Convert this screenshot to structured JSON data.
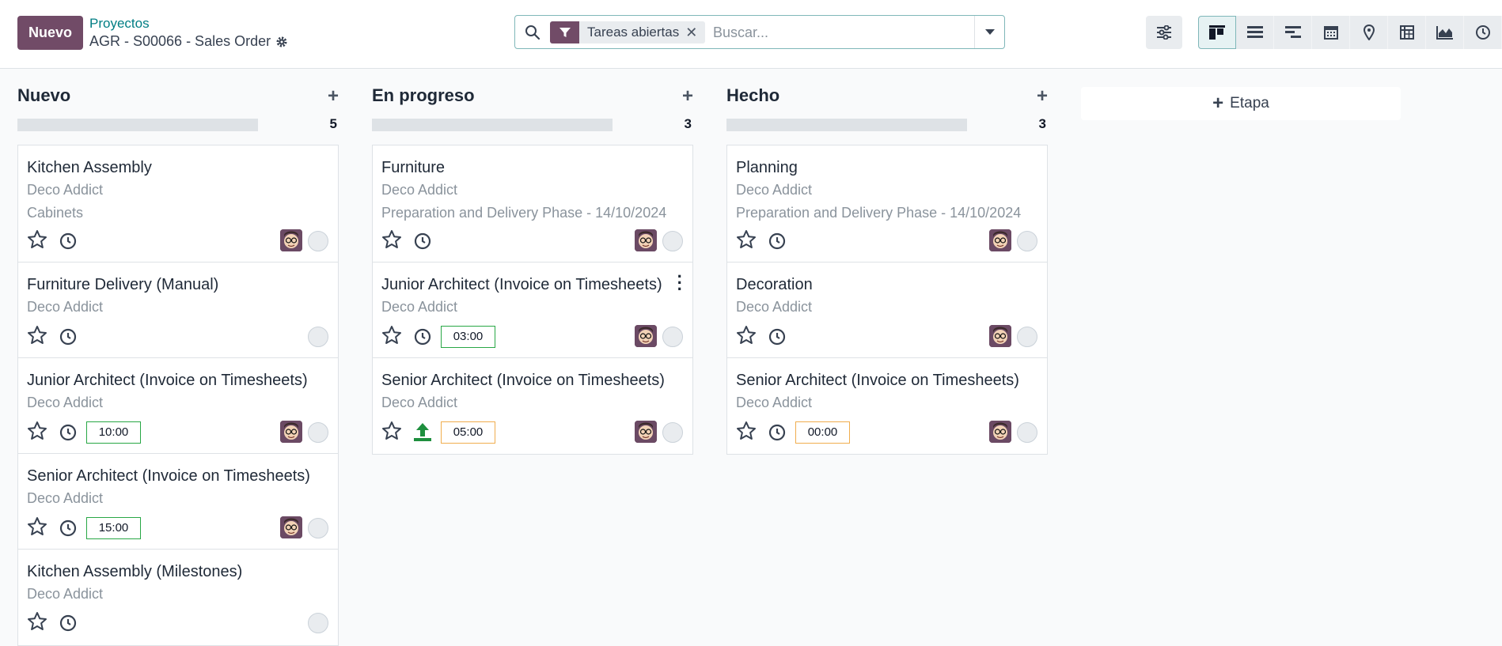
{
  "header": {
    "new_button": "Nuevo",
    "breadcrumb_parent": "Proyectos",
    "breadcrumb_current": "AGR - S00066 - Sales Order",
    "search": {
      "facet_label": "Tareas abiertas",
      "placeholder": "Buscar..."
    }
  },
  "views": [
    "kanban-icon",
    "list-icon",
    "gantt-icon",
    "calendar-icon",
    "map-pin-icon",
    "pivot-icon",
    "graph-icon",
    "activity-icon"
  ],
  "columns": [
    {
      "title": "Nuevo",
      "count": "5",
      "cards": [
        {
          "title": "Kitchen Assembly",
          "customer": "Deco Addict",
          "extra": "Cabinets",
          "time": ""
        },
        {
          "title": "Furniture Delivery (Manual)",
          "customer": "Deco Addict",
          "extra": "",
          "time": ""
        },
        {
          "title": "Junior Architect (Invoice on Timesheets)",
          "customer": "Deco Addict",
          "extra": "",
          "time": "10:00"
        },
        {
          "title": "Senior Architect (Invoice on Timesheets)",
          "customer": "Deco Addict",
          "extra": "",
          "time": "15:00"
        },
        {
          "title": "Kitchen Assembly (Milestones)",
          "customer": "Deco Addict",
          "extra": "",
          "time": ""
        }
      ]
    },
    {
      "title": "En progreso",
      "count": "3",
      "cards": [
        {
          "title": "Furniture",
          "customer": "Deco Addict",
          "extra": "Preparation and Delivery Phase - 14/10/2024",
          "time": ""
        },
        {
          "title": "Junior Architect (Invoice on Timesheets)",
          "customer": "Deco Addict",
          "extra": "",
          "time": "03:00"
        },
        {
          "title": "Senior Architect (Invoice on Timesheets)",
          "customer": "Deco Addict",
          "extra": "",
          "time": "05:00"
        }
      ]
    },
    {
      "title": "Hecho",
      "count": "3",
      "cards": [
        {
          "title": "Planning",
          "customer": "Deco Addict",
          "extra": "Preparation and Delivery Phase - 14/10/2024",
          "time": ""
        },
        {
          "title": "Decoration",
          "customer": "Deco Addict",
          "extra": "",
          "time": ""
        },
        {
          "title": "Senior Architect (Invoice on Timesheets)",
          "customer": "Deco Addict",
          "extra": "",
          "time": "00:00"
        }
      ]
    }
  ],
  "add_stage_label": "Etapa",
  "colors": {
    "brand": "#714b67",
    "accent": "#017e84",
    "time_ok": "#28a745",
    "time_warn": "#f0ad4e"
  }
}
